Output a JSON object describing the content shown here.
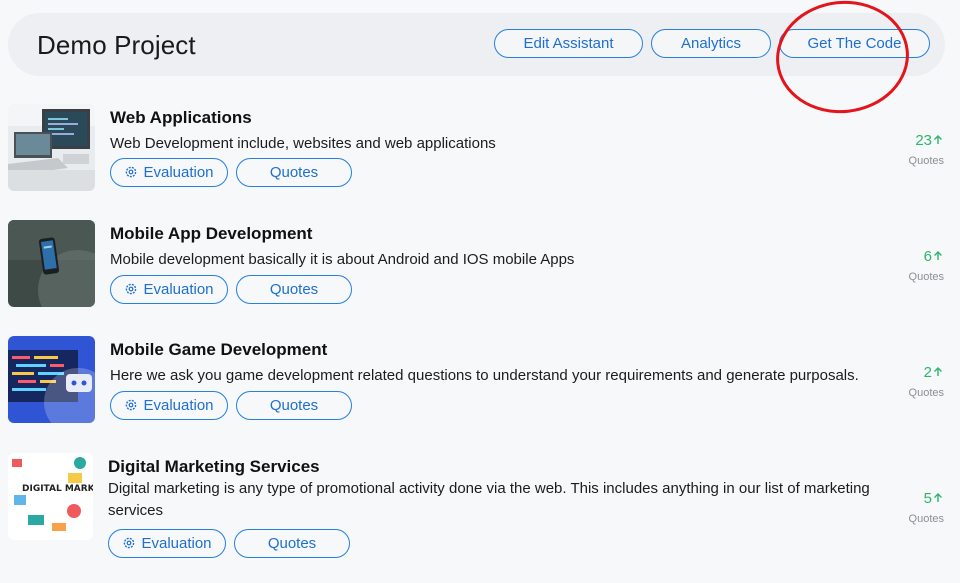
{
  "header": {
    "project_title": "Demo Project",
    "buttons": {
      "edit_assistant": "Edit Assistant",
      "analytics": "Analytics",
      "get_code": "Get The Code"
    }
  },
  "services": [
    {
      "title": "Web Applications",
      "description": "Web Development include, websites and web applications",
      "evaluation_label": "Evaluation",
      "quotes_label": "Quotes",
      "count": "23",
      "count_label": "Quotes"
    },
    {
      "title": "Mobile App Development",
      "description": "Mobile development basically it is about Android and IOS mobile Apps",
      "evaluation_label": "Evaluation",
      "quotes_label": "Quotes",
      "count": "6",
      "count_label": "Quotes"
    },
    {
      "title": "Mobile Game Development",
      "description": "Here we ask you game development related questions to understand your requirements and generate purposals.",
      "evaluation_label": "Evaluation",
      "quotes_label": "Quotes",
      "count": "2",
      "count_label": "Quotes"
    },
    {
      "title": "Digital Marketing Services",
      "description": "Digital marketing is any type of promotional activity done via the web. This includes anything in our list of marketing services",
      "evaluation_label": "Evaluation",
      "quotes_label": "Quotes",
      "count": "5",
      "count_label": "Quotes",
      "thumbnail_text": "DIGITAL MARKETING"
    }
  ],
  "icons": {
    "evaluation": "gear-icon",
    "count_trend": "arrow-up-icon"
  },
  "colors": {
    "accent": "#1e6fd0",
    "trend": "#2fb46e",
    "annotation": "#e3141b"
  }
}
